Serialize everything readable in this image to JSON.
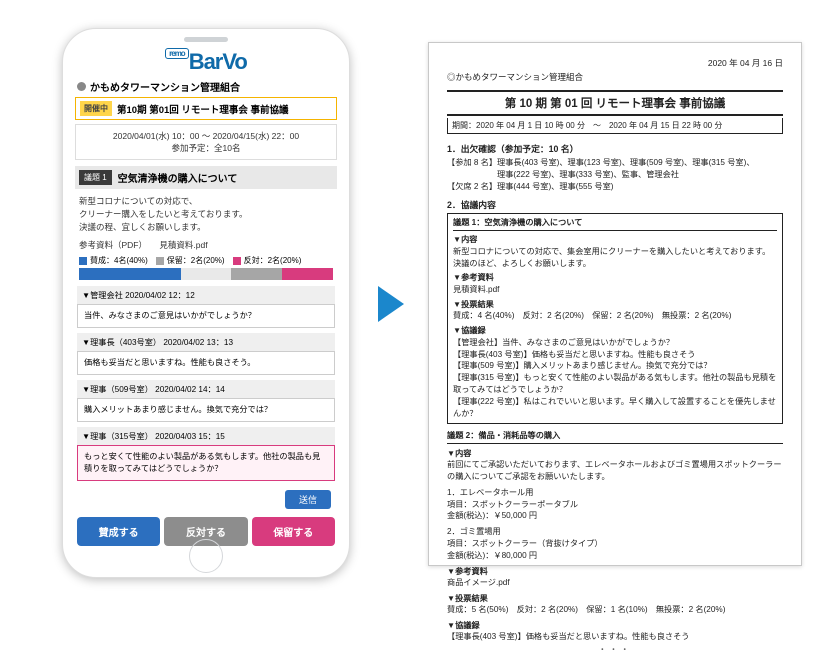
{
  "logo": {
    "remo": "remo",
    "text": "BarVo"
  },
  "association": "かもめタワーマンション管理組合",
  "status_badge": "開催中",
  "meeting_title": "第10期 第01回 リモート理事会 事前協議",
  "schedule": {
    "range": "2020/04/01(水) 10：00 ～ 2020/04/15(水) 22：00",
    "participants": "参加予定：全10名"
  },
  "topic": {
    "num": "議題 1",
    "title": "空気清浄機の購入について",
    "body_l1": "新型コロナについての対応で、",
    "body_l2": "クリーナー購入をしたいと考えております。",
    "body_l3": "決議の程、宜しくお願いします。",
    "ref_label": "参考資料（PDF）",
    "ref_file": "見積資料.pdf"
  },
  "vote": {
    "aye": {
      "label": "賛成：4名(40%)",
      "pct": 40
    },
    "hold": {
      "label": "保留：2名(20%)",
      "pct": 20
    },
    "nay": {
      "label": "反対：2名(20%)",
      "pct": 20
    },
    "none_pct": 20
  },
  "comments": [
    {
      "author": "▼管理会社",
      "ts": "2020/04/02 12：12",
      "body": "当件、みなさまのご意見はいかがでしょうか？"
    },
    {
      "author": "▼理事長（403号室）",
      "ts": "2020/04/02 13：13",
      "body": "価格も妥当だと思いますね。性能も良さそう。"
    },
    {
      "author": "▼理事（509号室）",
      "ts": "2020/04/02 14：14",
      "body": "購入メリットあまり感じません。換気で充分では？"
    },
    {
      "author": "▼理事（315号室）",
      "ts": "2020/04/03 15：15",
      "body": "もっと安くて性能のよい製品がある気もします。他社の製品も見積りを取ってみてはどうでしょうか？"
    }
  ],
  "send": "送信",
  "actions": {
    "aye": "賛成する",
    "nay": "反対する",
    "hold": "保留する"
  },
  "doc": {
    "date": "2020 年 04 月 16 日",
    "assoc": "◎かもめタワーマンション管理組合",
    "title": "第 10 期 第 01 回 リモート理事会 事前協議",
    "period": "期間：2020 年 04 月 1 日 10 時 00 分　～　2020 年 04 月 15 日 22 時 00 分",
    "sec1_title": "1．出欠確認（参加予定：10 名）",
    "sec1_present": "【参加 8 名】理事長(403 号室)、理事(123 号室)、理事(509 号室)、理事(315 号室)、",
    "sec1_present2": "理事(222 号室)、理事(333 号室)、監事、管理会社",
    "sec1_absent": "【欠席 2 名】理事(444 号室)、理事(555 号室)",
    "sec2_title": "2．協議内容",
    "t1_head": "議題 1：空気清浄機の購入について",
    "content_label": "▼内容",
    "t1_content": "新型コロナについての対応で、集会室用にクリーナーを購入したいと考えております。\n決議のほど、よろしくお願いします。",
    "ref_label": "▼参考資料",
    "t1_ref": "見積資料.pdf",
    "vote_label": "▼投票結果",
    "t1_vote": "賛成：4 名(40%)　反対：2 名(20%)　保留：2 名(20%)　無投票：2 名(20%)",
    "log_label": "▼協議録",
    "log1": "【管理会社】当件、みなさまのご意見はいかがでしょうか？",
    "log2": "【理事長(403 号室)】価格も妥当だと思いますね。性能も良さそう",
    "log3": "【理事(509 号室)】購入メリットあまり感じません。換気で充分では？",
    "log4": "【理事(315 号室)】もっと安くて性能のよい製品がある気もします。他社の製品も見積を取ってみてはどうでしょうか？",
    "log5": "【理事(222 号室)】私はこれでいいと思います。早く購入して設置することを優先しませんか？",
    "t2_head": "議題 2：備品・消耗品等の購入",
    "t2_content": "前回にてご承認いただいております、エレベータホールおよびゴミ置場用スポットクーラーの購入についてご承認をお願いいたします。",
    "t2_i1_l1": "1．エレベータホール用",
    "t2_i1_l2": "項目：スポットクーラーポータブル",
    "t2_i1_l3": "金額(税込)：￥50,000 円",
    "t2_i2_l1": "2．ゴミ置場用",
    "t2_i2_l2": "項目：スポットクーラー（背抜けタイプ）",
    "t2_i2_l3": "金額(税込)：￥80,000 円",
    "t2_ref": "商品イメージ.pdf",
    "t2_vote": "賛成：5 名(50%)　反対：2 名(20%)　保留：1 名(10%)　無投票：2 名(20%)",
    "t2_log1": "【理事長(403 号室)】価格も妥当だと思いますね。性能も良さそう"
  }
}
